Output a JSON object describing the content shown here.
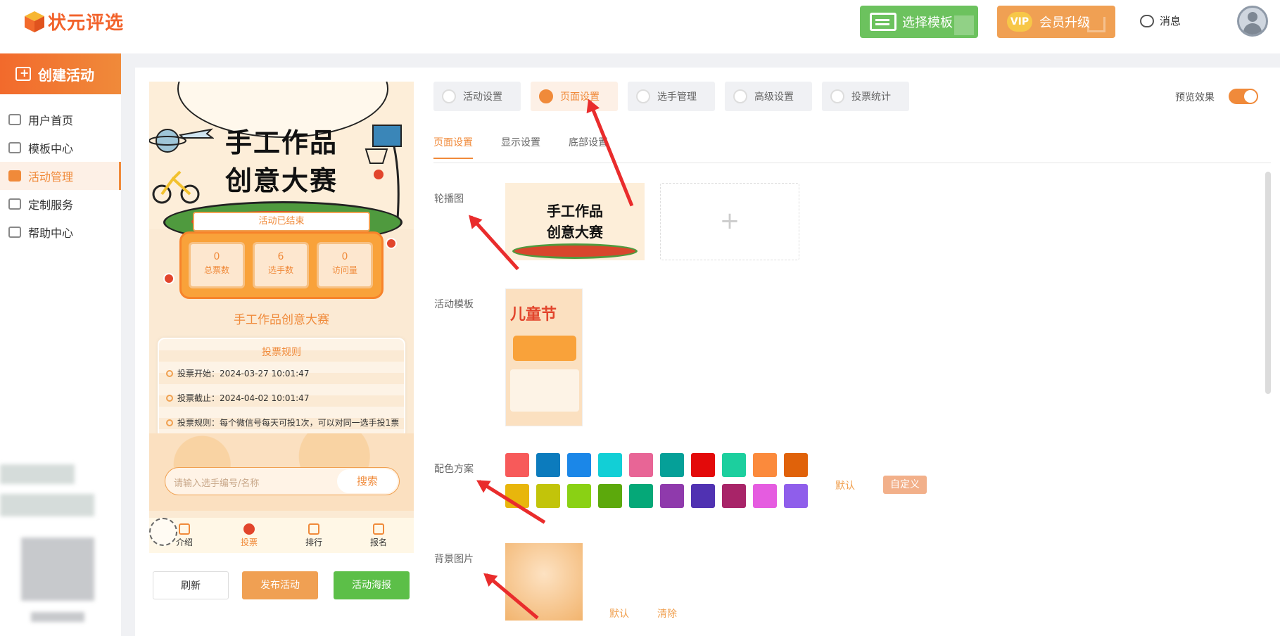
{
  "brand": {
    "name": "状元评选",
    "accent": "#f08a3a",
    "green": "#6cc25e",
    "red": "#e92c2c"
  },
  "header": {
    "choose_template": "选择模板",
    "vip_badge": "VIP",
    "vip_upgrade": "会员升级",
    "messages": "消息"
  },
  "sidebar": {
    "create": "创建活动",
    "items": [
      {
        "label": "用户首页",
        "icon": "home-icon"
      },
      {
        "label": "模板中心",
        "icon": "folder-icon"
      },
      {
        "label": "活动管理",
        "icon": "ticket-icon"
      },
      {
        "label": "定制服务",
        "icon": "puzzle-icon"
      },
      {
        "label": "帮助中心",
        "icon": "help-icon"
      }
    ]
  },
  "preview": {
    "banner_line1": "手工作品",
    "banner_line2": "创意大赛",
    "status": "活动已结束",
    "stats": [
      {
        "value": "0",
        "label": "总票数"
      },
      {
        "value": "6",
        "label": "选手数"
      },
      {
        "value": "0",
        "label": "访问量"
      }
    ],
    "activity_name": "手工作品创意大赛",
    "rules_title": "投票规则",
    "rules": [
      "投票开始：2024-03-27 10:01:47",
      "投票截止：2024-04-02 10:01:47",
      "投票规则：每个微信号每天可投1次，可以对同一选手投1票"
    ],
    "search_placeholder": "请输入选手编号/名称",
    "search_button": "搜索",
    "tabs": [
      "介绍",
      "投票",
      "排行",
      "报名"
    ],
    "buttons": {
      "refresh": "刷新",
      "publish": "发布活动",
      "poster": "活动海报"
    }
  },
  "settings": {
    "top_tabs": [
      "活动设置",
      "页面设置",
      "选手管理",
      "高级设置",
      "投票统计"
    ],
    "preview_label": "预览效果",
    "preview_on": true,
    "sub_tabs": [
      "页面设置",
      "显示设置",
      "底部设置"
    ],
    "carousel_label": "轮播图",
    "template_label": "活动模板",
    "template_thumb_title": "儿童节",
    "color_label": "配色方案",
    "colors_row1": [
      "#f75a5a",
      "#0c7bbd",
      "#1b87e8",
      "#12cfd6",
      "#e86596",
      "#05a098",
      "#e30a0a",
      "#1ccf9e",
      "#fb8a3c",
      "#e0620a"
    ],
    "colors_row2": [
      "#e8b60c",
      "#c2c40a",
      "#8ad114",
      "#5ca90c",
      "#05a878",
      "#8f3aac",
      "#5032b2",
      "#a82468",
      "#e55ce0",
      "#8f5eeb"
    ],
    "color_default": "默认",
    "color_custom": "自定义",
    "bg_label": "背景图片",
    "bg_default": "默认",
    "bg_clear": "清除"
  }
}
